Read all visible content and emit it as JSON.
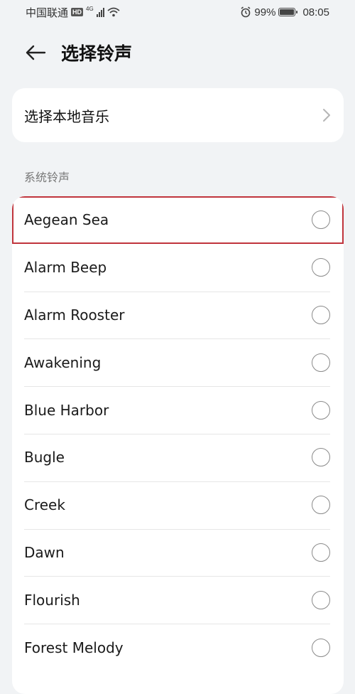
{
  "status_bar": {
    "carrier": "中国联通",
    "hd_badge": "HD",
    "network_type": "4G",
    "battery_percent": "99%",
    "battery_level": 0.99,
    "time": "08:05"
  },
  "header": {
    "title": "选择铃声",
    "back_icon": "arrow-left-icon"
  },
  "local_music": {
    "label": "选择本地音乐",
    "chevron_icon": "chevron-right-icon"
  },
  "section": {
    "label": "系统铃声"
  },
  "ringtones": [
    {
      "label": "Aegean Sea",
      "selected": false,
      "highlighted": true
    },
    {
      "label": "Alarm Beep",
      "selected": false
    },
    {
      "label": "Alarm Rooster",
      "selected": false
    },
    {
      "label": "Awakening",
      "selected": false
    },
    {
      "label": "Blue Harbor",
      "selected": false
    },
    {
      "label": "Bugle",
      "selected": false
    },
    {
      "label": "Creek",
      "selected": false
    },
    {
      "label": "Dawn",
      "selected": false
    },
    {
      "label": "Flourish",
      "selected": false
    },
    {
      "label": "Forest Melody",
      "selected": false
    }
  ],
  "colors": {
    "background": "#f1f3f5",
    "card": "#ffffff",
    "highlight_border": "#c0343c"
  }
}
